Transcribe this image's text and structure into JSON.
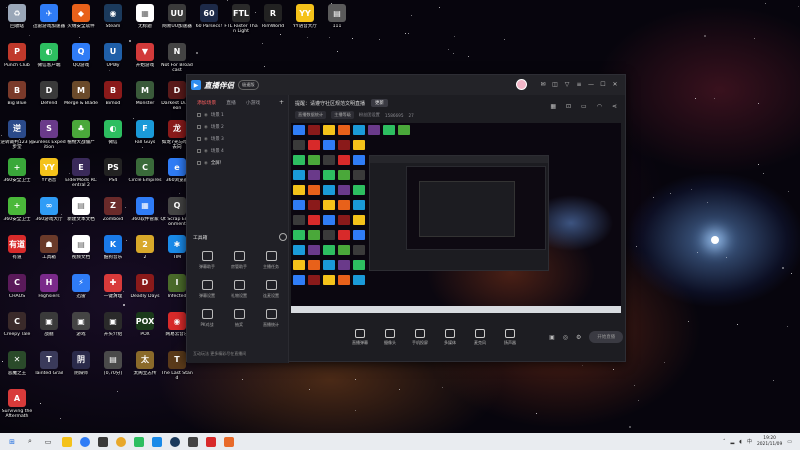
{
  "desktop": {
    "icons": [
      {
        "label": "回收站",
        "color": "#9aa7b8",
        "glyph": "♻"
      },
      {
        "label": "迅雷游戏加速器",
        "color": "#2f7cf6",
        "glyph": "✈"
      },
      {
        "label": "火绒安全软件",
        "color": "#e8611a",
        "glyph": "◆"
      },
      {
        "label": "Steam",
        "color": "#1b3a5c",
        "glyph": "◉"
      },
      {
        "label": "无标题",
        "color": "#ffffff",
        "glyph": "▦"
      },
      {
        "label": "网易UU加速器",
        "color": "#3a3a3a",
        "glyph": "UU"
      },
      {
        "label": "60 Parsecs!",
        "color": "#1d2a48",
        "glyph": "60"
      },
      {
        "label": "FTL Faster Than Light",
        "color": "#2a2a2a",
        "glyph": "FTL"
      },
      {
        "label": "RimWorld",
        "color": "#222222",
        "glyph": "R"
      },
      {
        "label": "YY语音大厅",
        "color": "#f4c21a",
        "glyph": "YY"
      },
      {
        "label": "111",
        "color": "#5a5a5a",
        "glyph": "▤"
      },
      {
        "label": "Punch Club",
        "color": "#c0392b",
        "glyph": "P"
      },
      {
        "label": "微信客户端",
        "color": "#2dbe60",
        "glyph": "◐"
      },
      {
        "label": "QQ游戏",
        "color": "#2f7cf6",
        "glyph": "Q"
      },
      {
        "label": "UPlay",
        "color": "#1f5fa8",
        "glyph": "U"
      },
      {
        "label": "开始游戏",
        "color": "#d23a3a",
        "glyph": "▼"
      },
      {
        "label": "Not For Broadcast",
        "color": "#444444",
        "glyph": "N"
      },
      {
        "label": "Big Blue",
        "color": "#7a3a2a",
        "glyph": "B"
      },
      {
        "label": "Defend",
        "color": "#3a3a3a",
        "glyph": "D"
      },
      {
        "label": "Merge & Blade",
        "color": "#6a4a2a",
        "glyph": "M"
      },
      {
        "label": "Bimod",
        "color": "#8a1a1a",
        "glyph": "B"
      },
      {
        "label": "Monster",
        "color": "#3a5a3a",
        "glyph": "M"
      },
      {
        "label": "Darkest Dungeon",
        "color": "#5a1a1a",
        "glyph": "D"
      },
      {
        "label": "逆转裁判123 成步堂",
        "color": "#2a4a8a",
        "glyph": "逆"
      },
      {
        "label": "Sunless Expedition",
        "color": "#6a3a8a",
        "glyph": "S"
      },
      {
        "label": "植物大战僵尸",
        "color": "#4aa83a",
        "glyph": "♣"
      },
      {
        "label": "微信",
        "color": "#2dbe60",
        "glyph": "◐"
      },
      {
        "label": "Fall Guys",
        "color": "#1a9ad8",
        "glyph": "F"
      },
      {
        "label": "如龙7光与暗的去向",
        "color": "#8a1a1a",
        "glyph": "龙"
      },
      {
        "label": "360安全卫士",
        "color": "#3aa83a",
        "glyph": "+"
      },
      {
        "label": "YY语音",
        "color": "#f4c21a",
        "glyph": "YY"
      },
      {
        "label": "ElderMods RCentral 2",
        "color": "#3a2a5a",
        "glyph": "E"
      },
      {
        "label": "PS4",
        "color": "#222222",
        "glyph": "PS"
      },
      {
        "label": "Circle Empires",
        "color": "#3a6a3a",
        "glyph": "C"
      },
      {
        "label": "360浏览器",
        "color": "#2f7cf6",
        "glyph": "e"
      },
      {
        "label": "360安全卫士",
        "color": "#4ab83a",
        "glyph": "+"
      },
      {
        "label": "360游戏大厅",
        "color": "#2f9cf6",
        "glyph": "∞"
      },
      {
        "label": "新建文本文档",
        "color": "#ffffff",
        "glyph": "▤"
      },
      {
        "label": "Zomboid",
        "color": "#6a2a2a",
        "glyph": "Z"
      },
      {
        "label": "360软件管家",
        "color": "#2f7cf6",
        "glyph": "▦"
      },
      {
        "label": "Qt Scrap Environment",
        "color": "#444444",
        "glyph": "Q"
      },
      {
        "label": "有道",
        "color": "#d82a2a",
        "glyph": "有道"
      },
      {
        "label": "工具箱",
        "color": "#6a3a2a",
        "glyph": "☗"
      },
      {
        "label": "视频文档",
        "color": "#ffffff",
        "glyph": "▤"
      },
      {
        "label": "酷狗音乐",
        "color": "#1a7ae8",
        "glyph": "K"
      },
      {
        "label": "2",
        "color": "#d8a82a",
        "glyph": "2"
      },
      {
        "label": "TIM",
        "color": "#1a8ae8",
        "glyph": "✱"
      },
      {
        "label": "CHAOS",
        "color": "#5a1a5a",
        "glyph": "C"
      },
      {
        "label": "Highsiers",
        "color": "#7a2a8a",
        "glyph": "H"
      },
      {
        "label": "迅雷",
        "color": "#2f7cf6",
        "glyph": "⚡"
      },
      {
        "label": "一键清理",
        "color": "#d83a3a",
        "glyph": "✚"
      },
      {
        "label": "Deadly Days",
        "color": "#8a1a1a",
        "glyph": "D"
      },
      {
        "label": "Infected",
        "color": "#4a6a2a",
        "glyph": "I"
      },
      {
        "label": "Creepy Tale",
        "color": "#3a2a2a",
        "glyph": "C"
      },
      {
        "label": "战舰",
        "color": "#3a3a3a",
        "glyph": "▣"
      },
      {
        "label": "游戏",
        "color": "#444444",
        "glyph": "▣"
      },
      {
        "label": "开头介绍",
        "color": "#2a2a2a",
        "glyph": "▣"
      },
      {
        "label": "POX",
        "color": "#1a3a1a",
        "glyph": "POX"
      },
      {
        "label": "网易云音乐",
        "color": "#d82a2a",
        "glyph": "◉"
      },
      {
        "label": "恶魔之王",
        "color": "#2a4a2a",
        "glyph": "✕"
      },
      {
        "label": "Tainted Grail",
        "color": "#3a3a5a",
        "glyph": "T"
      },
      {
        "label": "阴阳师",
        "color": "#2a2a4a",
        "glyph": "阴"
      },
      {
        "label": "[0,70分]",
        "color": "#4a4a4a",
        "glyph": "▤"
      },
      {
        "label": "太阁立志传",
        "color": "#8a6a2a",
        "glyph": "太"
      },
      {
        "label": "The Last Stand",
        "color": "#5a3a1a",
        "glyph": "T"
      },
      {
        "label": "Surviving the Aftermath",
        "color": "#d83a3a",
        "glyph": "A"
      }
    ]
  },
  "app": {
    "name": "直播伴侣",
    "badge": "极速版",
    "left_tabs": [
      "添加场景",
      "直播",
      "小游戏"
    ],
    "scenes": [
      "场景 1",
      "场景 2",
      "场景 3",
      "场景 4",
      "全屏！"
    ],
    "toolbox_title": "工具箱",
    "tools": [
      "弹幕助手",
      "房管助手",
      "主播任务",
      "弹幕设置",
      "礼物设置",
      "连麦设置",
      "PK对战",
      "抽奖",
      "直播统计"
    ],
    "left_footer": "互动玩法 更多精彩尽在直播间",
    "announcement": "提醒：请遵守社区规范文明直播",
    "announcement_button": "更新",
    "meta_pills": [
      "直播数据统计",
      "主播等级",
      "粉丝团设置",
      "1586695",
      "27"
    ],
    "controls": [
      "直播弹幕",
      "摄像头",
      "手机投屏",
      "多媒体",
      "麦克风",
      "扬声器"
    ],
    "start_button": "开始直播"
  },
  "taskbar": {
    "time": "19:20",
    "date": "2021/11/09"
  }
}
